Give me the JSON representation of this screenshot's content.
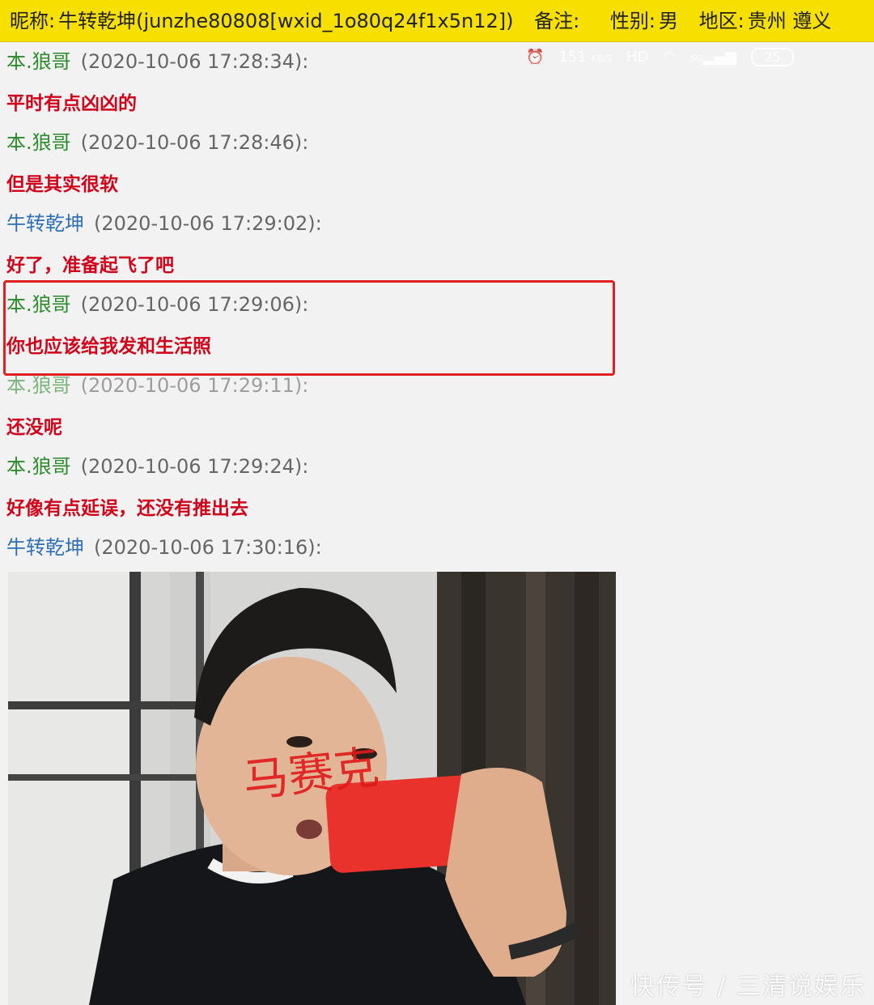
{
  "header": {
    "nickname_label": "昵称:",
    "nickname_value": "牛转乾坤(junzhe80808[wxid_1o80q24f1x5n12])",
    "remark_label": "备注:",
    "gender_label": "性别:",
    "gender_value": "男",
    "region_label": "地区:",
    "region_value": "贵州 遵义"
  },
  "status_overlay": {
    "speed": "151",
    "speed_unit": "KB/S",
    "hd": "HD",
    "network": "5G",
    "battery": "25"
  },
  "messages": [
    {
      "sender": "本.狼哥",
      "time": "(2020-10-06 17:28:34):",
      "text": "平时有点凶凶的"
    },
    {
      "sender": "本.狼哥",
      "time": "(2020-10-06 17:28:46):",
      "text": "但是其实很软"
    },
    {
      "sender": "牛转乾坤",
      "time": "(2020-10-06 17:29:02):",
      "text": "好了，准备起飞了吧"
    },
    {
      "sender": "本.狼哥",
      "time": "(2020-10-06 17:29:06):",
      "text": "你也应该给我发和生活照"
    },
    {
      "sender": "本.狼哥",
      "time": "(2020-10-06 17:29:11):",
      "text": "还没呢"
    },
    {
      "sender": "本.狼哥",
      "time": "(2020-10-06 17:29:24):",
      "text": "好像有点延误，还没有推出去"
    },
    {
      "sender": "牛转乾坤",
      "time": "(2020-10-06 17:30:16):",
      "text": ""
    }
  ],
  "photo": {
    "handwritten_text": "马赛克",
    "phone_color": "#e8322b"
  },
  "watermark": "快传号 / 三清说娱乐",
  "colors": {
    "header_bg": "#f7e000",
    "sender_green": "#2e8b2e",
    "sender_blue": "#2f6fb8",
    "message_red": "#d0021b",
    "highlight_red": "#e02020"
  }
}
